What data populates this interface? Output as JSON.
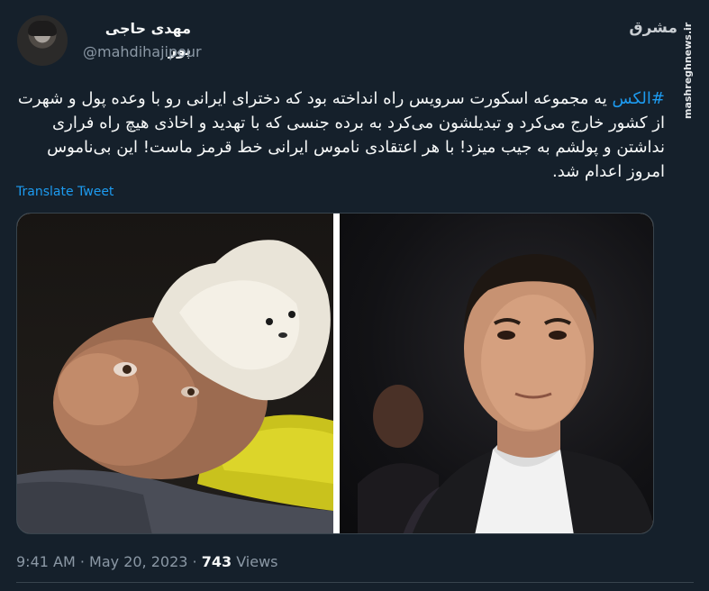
{
  "author": {
    "display_name": "مهدی حاجی پور",
    "handle": "@mahdihajipour"
  },
  "watermark": {
    "logo": "مشرق",
    "url": "mashreghnews.ir"
  },
  "tweet": {
    "hashtag": "#الکس",
    "body": " یه مجموعه اسکورت سرویس راه انداخته بود که دخترای ایرانی رو با وعده پول و شهرت از کشور خارج می‌کرد و تبدیلشون می‌کرد به برده جنسی که با تهدید و اخاذی هیچ راه فراری نداشتن و پولشم به جیب میزد! با هر اعتقادی ناموس ایرانی خط قرمز ماست! این بی‌ناموس امروز اعدام شد.",
    "translate_label": "Translate Tweet"
  },
  "meta": {
    "time": "9:41 AM",
    "separator1": " · ",
    "date": "May 20, 2023",
    "separator2": " · ",
    "views_count": "743",
    "views_label": " Views"
  },
  "colors": {
    "background": "#15202b",
    "accent": "#1d9bf0",
    "secondary_text": "#8b98a5"
  }
}
